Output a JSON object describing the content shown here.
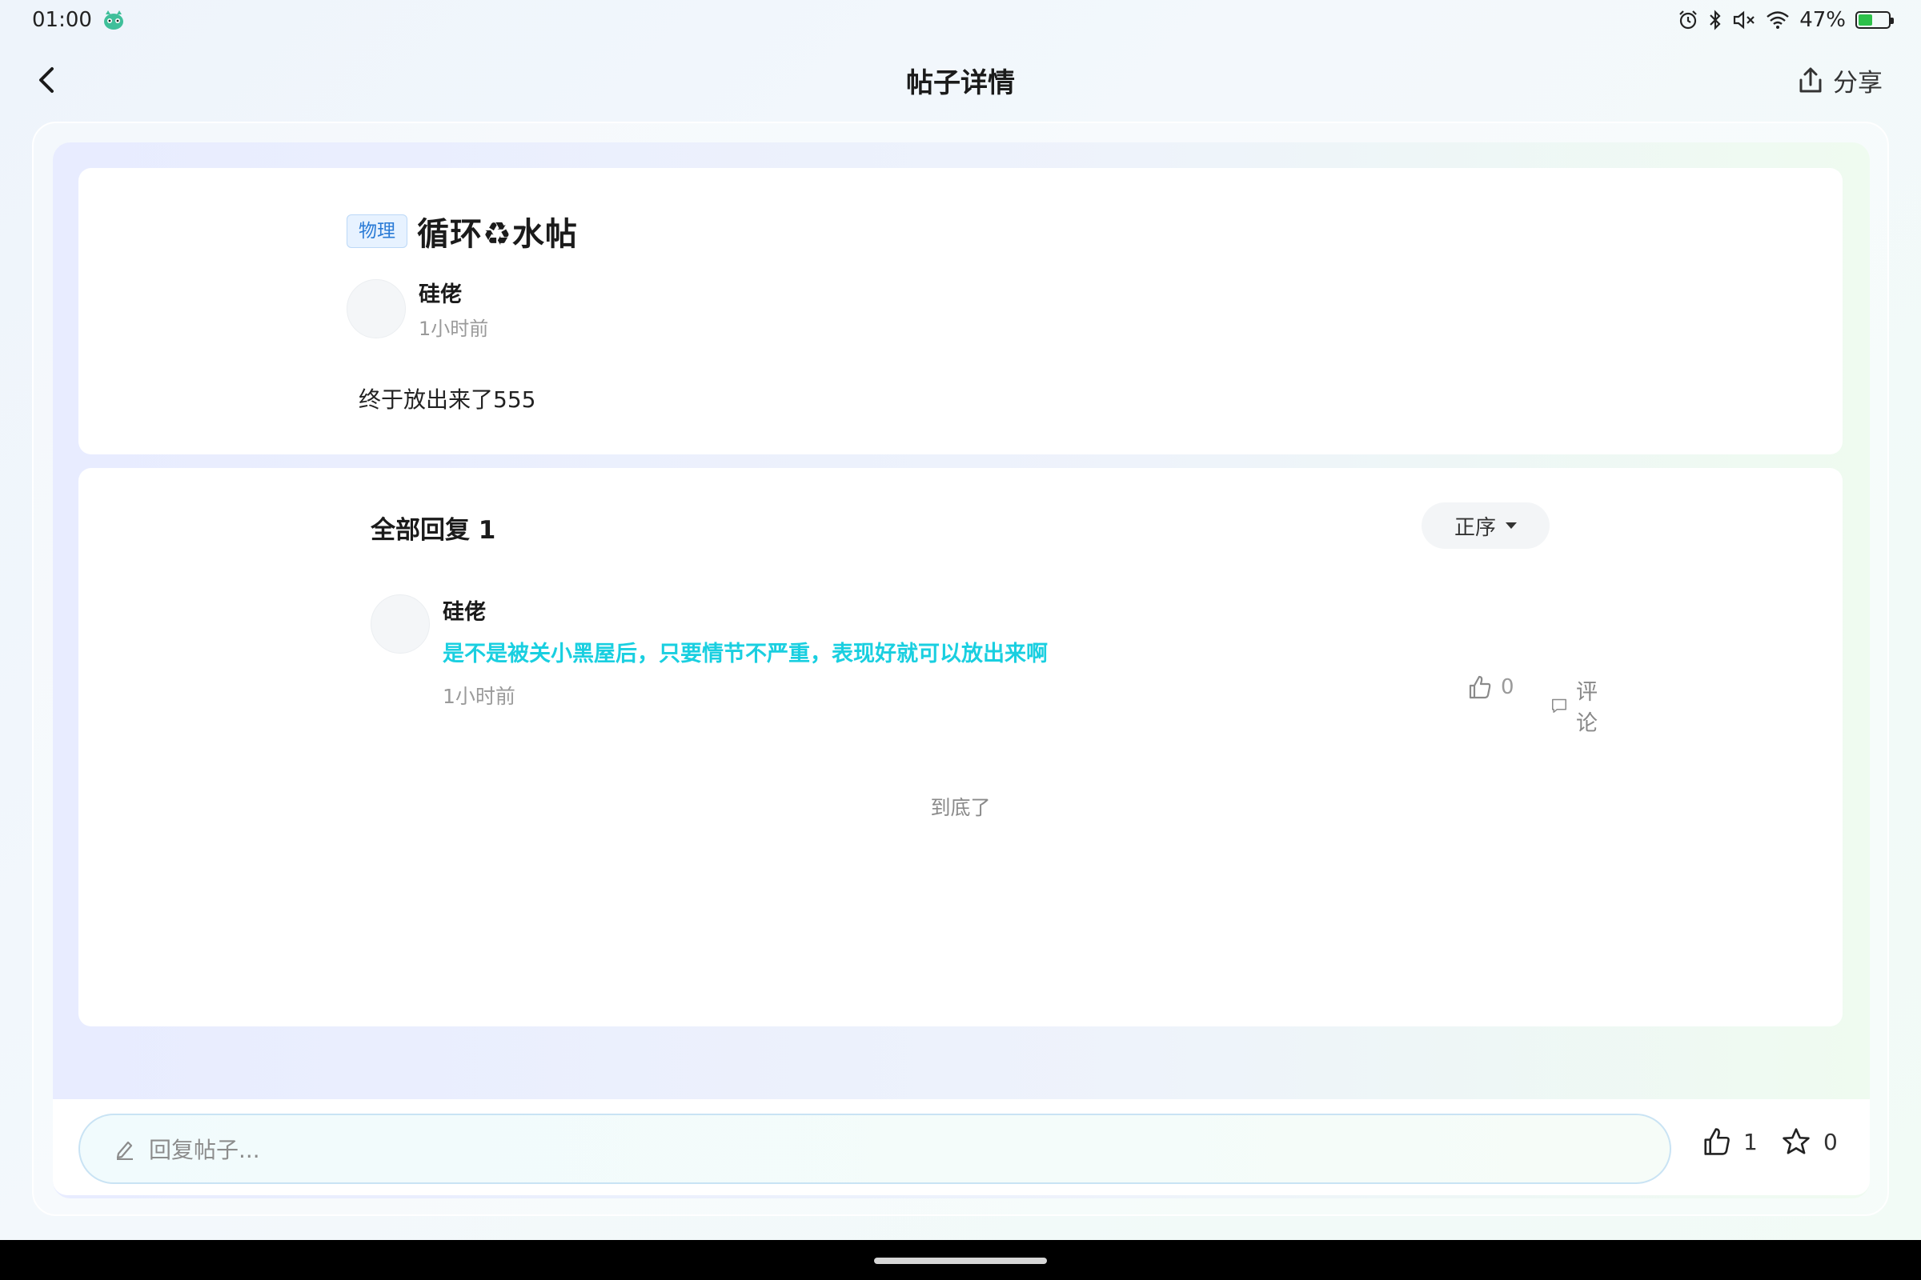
{
  "status_bar": {
    "time": "01:00",
    "battery": "47%",
    "battery_level": 0.47,
    "icons": [
      "mascot-icon",
      "alarm-icon",
      "bluetooth-icon",
      "mute-icon",
      "wifi-icon",
      "battery-icon"
    ]
  },
  "nav": {
    "title": "帖子详情",
    "share_label": "分享"
  },
  "post": {
    "tag": "物理",
    "title": "循环♻水帖",
    "author": "硅佬",
    "time": "1小时前",
    "body": "终于放出来了555"
  },
  "replies": {
    "title": "全部回复 1",
    "sort_label": "正序",
    "items": [
      {
        "author": "硅佬",
        "text": "是不是被关小黑屋后，只要情节不严重，表现好就可以放出来啊",
        "time": "1小时前",
        "likes": "0",
        "reply_label": "评论"
      }
    ],
    "end_text": "到底了"
  },
  "bottom_bar": {
    "reply_placeholder": "回复帖子...",
    "likes": "1",
    "favorites": "0"
  },
  "colors": {
    "tag_text": "#2a7bd6",
    "comment_text": "#19cfe0",
    "battery_fill": "#2ec14a"
  }
}
